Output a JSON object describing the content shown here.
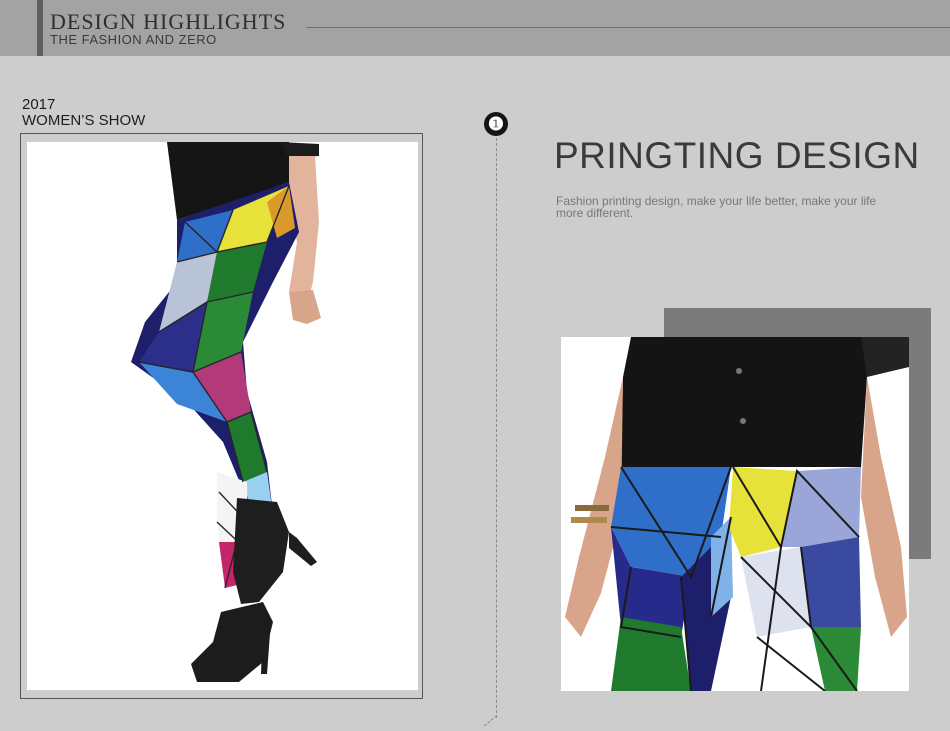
{
  "header": {
    "title": "DESIGN  HIGHLIGHTS",
    "subtitle": "THE FASHION AND ZERO"
  },
  "show": {
    "year": "2017",
    "title": "WOMEN’S SHOW"
  },
  "step": {
    "number": "❶"
  },
  "design": {
    "title": "PRINGTING DESIGN",
    "description": "Fashion printing design, make your life better, make your life more different."
  },
  "colors": {
    "background": "#cdcdcd",
    "header": "#a3a3a3",
    "shadow_block": "#7b7b7b",
    "pattern_blue": "#2f6fc9",
    "pattern_green": "#1f7a2e",
    "pattern_yellow": "#e6e23a",
    "pattern_navy": "#1d1f6b"
  }
}
